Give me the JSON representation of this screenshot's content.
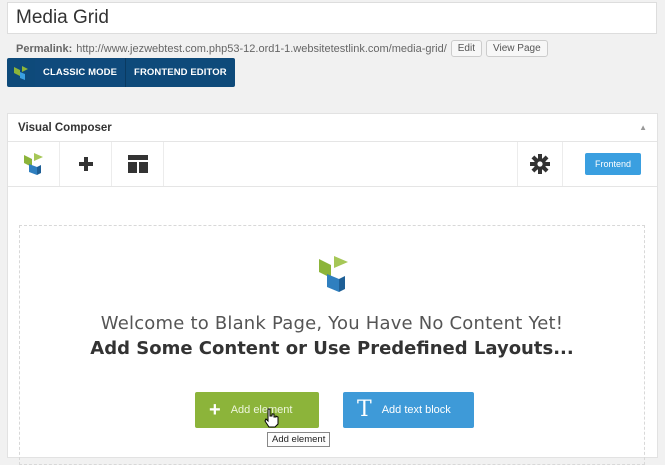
{
  "page": {
    "title": "Media Grid"
  },
  "permalink": {
    "label": "Permalink:",
    "url": "http://www.jezwebtest.com.php53-12.ord1-1.websitetestlink.com/media-grid/",
    "edit_label": "Edit",
    "view_label": "View Page"
  },
  "mode_bar": {
    "classic_label": "CLASSIC MODE",
    "frontend_label": "FRONTEND EDITOR"
  },
  "composer": {
    "title": "Visual Composer",
    "frontend_button": "Frontend",
    "welcome": "Welcome to Blank Page, You Have No Content Yet!",
    "subtitle": "Add Some Content or Use Predefined Layouts...",
    "add_element_label": "Add element",
    "add_text_block_label": "Add text block",
    "tooltip": "Add element"
  },
  "icons": {
    "logo": "vc-logo-icon",
    "add": "plus-icon",
    "templates": "layout-icon",
    "settings": "gear-icon",
    "collapse": "triangle-up-icon",
    "text": "text-t-icon",
    "cursor": "hand-pointer-icon"
  },
  "colors": {
    "accent_blue": "#3e9ad8",
    "accent_green": "#8cb43a",
    "mode_bar": "#0e4a7a"
  }
}
